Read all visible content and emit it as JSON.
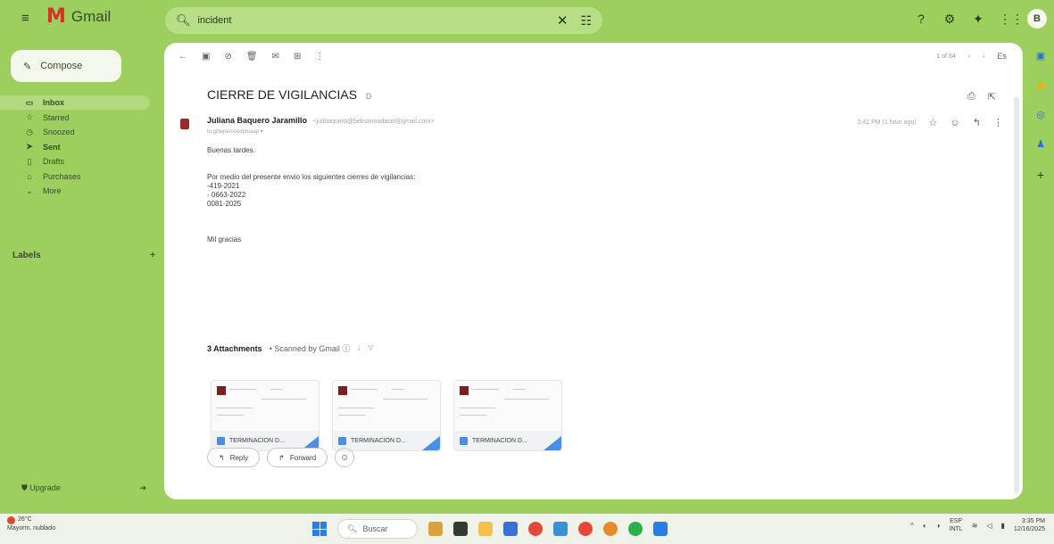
{
  "app": {
    "name": "Gmail",
    "avatar_letter": "B"
  },
  "search": {
    "query": "incident"
  },
  "compose": {
    "label": "Compose"
  },
  "nav": [
    {
      "icon": "inbox-icon",
      "label": "Inbox"
    },
    {
      "icon": "star-icon",
      "label": "Starred"
    },
    {
      "icon": "clock-icon",
      "label": "Snoozed"
    },
    {
      "icon": "send-icon",
      "label": "Sent"
    },
    {
      "icon": "draft-icon",
      "label": "Drafts"
    },
    {
      "icon": "tag-icon",
      "label": "Purchases"
    },
    {
      "icon": "chevron-down-icon",
      "label": "More"
    }
  ],
  "labels": {
    "title": "Labels",
    "add": "+"
  },
  "upgrade": {
    "label": "Upgrade"
  },
  "toolbar": {
    "pager": "1 of 64",
    "lang": "Es"
  },
  "email": {
    "subject": "CIERRE DE VIGILANCIAS",
    "subject_label": "D",
    "sender_name": "Juliana Baquero Jaramillo",
    "sender_email": "<julibaquero@bebsimoodasol@gmail.com>",
    "to": "to gibeperocodpmaap ▾",
    "time": "2:41 PM (1 hour ago)",
    "body": [
      "Buenas tardes.",
      "",
      "Por medio del presente envio los siguientes cierres de vigilancias:",
      "-419-2021",
      "- 0663-2022",
      " 0081-2025",
      "",
      "",
      "Mil gracias"
    ]
  },
  "attachments": {
    "count_label": "3 Attachments",
    "scanned": "• Scanned by Gmail ⓘ",
    "files": [
      {
        "name": "TERMINACION D..."
      },
      {
        "name": "TERMINACION D..."
      },
      {
        "name": "TERMINACION D..."
      }
    ]
  },
  "actions": {
    "reply": "Reply",
    "forward": "Forward"
  },
  "taskbar": {
    "temp": "26°C",
    "weather": "Mayorm. nublado",
    "search_placeholder": "Buscar",
    "lang_top": "ESP",
    "lang_bottom": "INTL",
    "time": "3:35 PM",
    "date": "12/16/2025"
  }
}
